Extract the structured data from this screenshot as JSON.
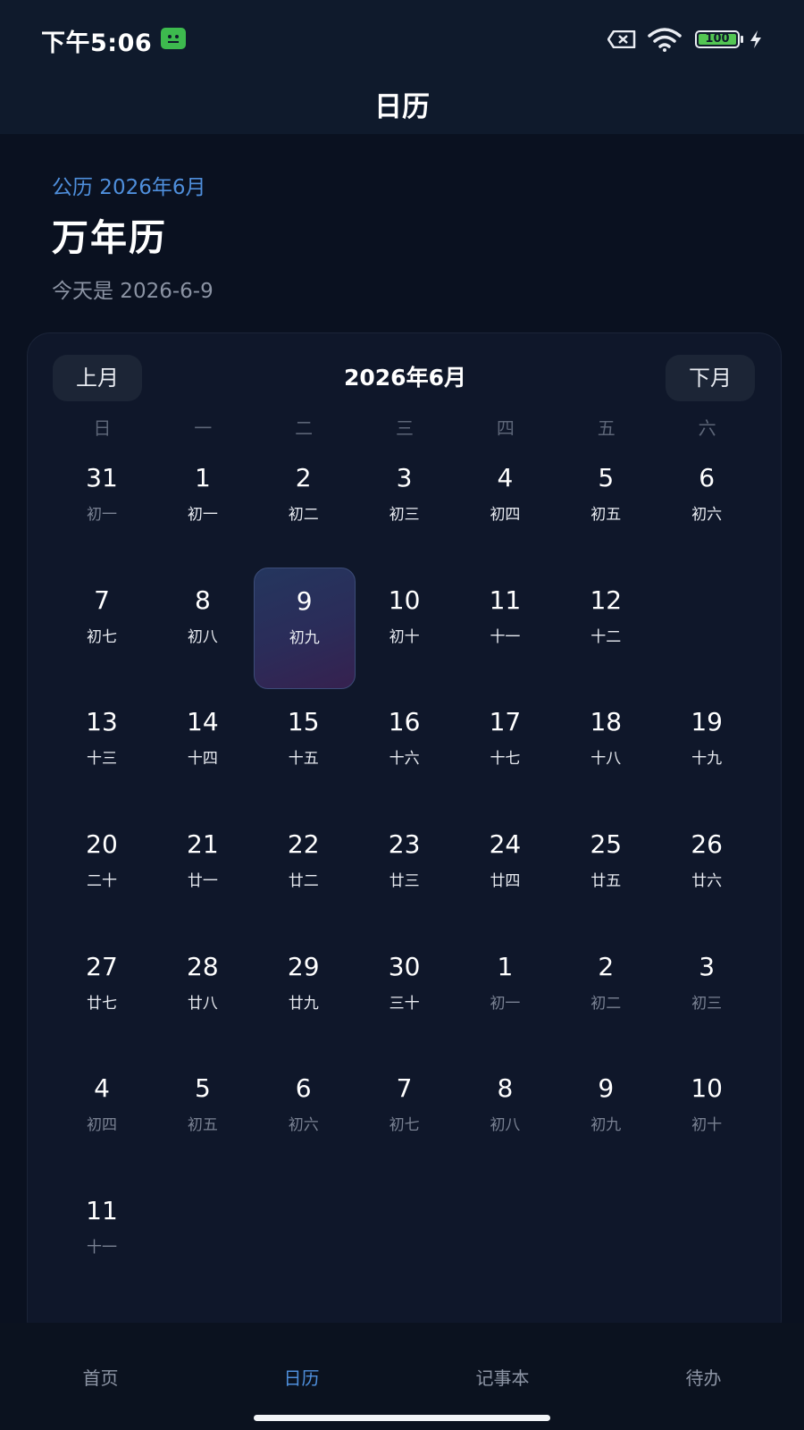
{
  "status_bar": {
    "time": "下午5:06",
    "battery": "100"
  },
  "app_bar": {
    "title": "日历"
  },
  "header": {
    "solar_label": "公历 2026年6月",
    "title": "万年历",
    "today": "今天是 2026-6-9"
  },
  "calendar": {
    "prev_label": "上月",
    "next_label": "下月",
    "month_title": "2026年6月",
    "weekdays": [
      "日",
      "一",
      "二",
      "三",
      "四",
      "五",
      "六"
    ],
    "weeks": [
      [
        {
          "num": "31",
          "lunar": "初一",
          "muted": true
        },
        {
          "num": "1",
          "lunar": "初一"
        },
        {
          "num": "2",
          "lunar": "初二"
        },
        {
          "num": "3",
          "lunar": "初三"
        },
        {
          "num": "4",
          "lunar": "初四"
        },
        {
          "num": "5",
          "lunar": "初五"
        },
        {
          "num": "6",
          "lunar": "初六"
        }
      ],
      [
        {
          "num": "7",
          "lunar": "初七"
        },
        {
          "num": "8",
          "lunar": "初八"
        },
        {
          "num": "9",
          "lunar": "初九",
          "selected": true
        },
        {
          "num": "10",
          "lunar": "初十"
        },
        {
          "num": "11",
          "lunar": "十一"
        },
        {
          "num": "12",
          "lunar": "十二"
        },
        null
      ],
      [
        {
          "num": "13",
          "lunar": "十三"
        },
        {
          "num": "14",
          "lunar": "十四"
        },
        {
          "num": "15",
          "lunar": "十五"
        },
        {
          "num": "16",
          "lunar": "十六"
        },
        {
          "num": "17",
          "lunar": "十七"
        },
        {
          "num": "18",
          "lunar": "十八"
        },
        {
          "num": "19",
          "lunar": "十九"
        }
      ],
      [
        {
          "num": "20",
          "lunar": "二十"
        },
        {
          "num": "21",
          "lunar": "廿一"
        },
        {
          "num": "22",
          "lunar": "廿二"
        },
        {
          "num": "23",
          "lunar": "廿三"
        },
        {
          "num": "24",
          "lunar": "廿四"
        },
        {
          "num": "25",
          "lunar": "廿五"
        },
        {
          "num": "26",
          "lunar": "廿六"
        }
      ],
      [
        {
          "num": "27",
          "lunar": "廿七"
        },
        {
          "num": "28",
          "lunar": "廿八"
        },
        {
          "num": "29",
          "lunar": "廿九"
        },
        {
          "num": "30",
          "lunar": "三十"
        },
        {
          "num": "1",
          "lunar": "初一",
          "muted": true
        },
        {
          "num": "2",
          "lunar": "初二",
          "muted": true
        },
        {
          "num": "3",
          "lunar": "初三",
          "muted": true
        }
      ],
      [
        {
          "num": "4",
          "lunar": "初四",
          "muted": true
        },
        {
          "num": "5",
          "lunar": "初五",
          "muted": true
        },
        {
          "num": "6",
          "lunar": "初六",
          "muted": true
        },
        {
          "num": "7",
          "lunar": "初七",
          "muted": true
        },
        {
          "num": "8",
          "lunar": "初八",
          "muted": true
        },
        {
          "num": "9",
          "lunar": "初九",
          "muted": true
        },
        {
          "num": "10",
          "lunar": "初十",
          "muted": true
        }
      ],
      [
        {
          "num": "11",
          "lunar": "十一",
          "muted": true
        },
        null,
        null,
        null,
        null,
        null,
        null
      ]
    ]
  },
  "tabs": [
    {
      "label": "首页"
    },
    {
      "label": "日历",
      "active": true
    },
    {
      "label": "记事本"
    },
    {
      "label": "待办"
    }
  ],
  "colors": {
    "accent": "#4f8fdc",
    "background": "#0a1120",
    "card": "#0f172a",
    "battery_green": "#53c653"
  },
  "icons": [
    "android-debug-icon",
    "no-sim-icon",
    "wifi-icon",
    "battery-icon",
    "charging-icon"
  ]
}
